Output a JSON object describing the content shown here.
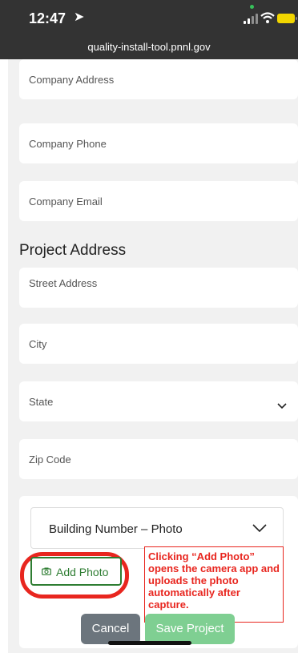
{
  "status": {
    "time": "12:47"
  },
  "browser": {
    "url": "quality-install-tool.pnnl.gov"
  },
  "company_fields": [
    {
      "label": "Company Address"
    },
    {
      "label": "Company Phone"
    },
    {
      "label": "Company Email"
    }
  ],
  "project_address": {
    "title": "Project Address",
    "street": "Street Address",
    "city": "City",
    "state": "State",
    "zip": "Zip Code"
  },
  "photo": {
    "selected": "Building Number – Photo",
    "add_label": "Add Photo"
  },
  "annotation": {
    "text": "Clicking “Add Photo” opens the camera app and uploads the photo automatically after capture."
  },
  "actions": {
    "cancel": "Cancel",
    "save": "Save Project"
  },
  "colors": {
    "accent_green": "#2e7d32",
    "annotation_red": "#e8261f",
    "save_disabled": "#7fcf92"
  },
  "icons": [
    "location-arrow-icon",
    "signal-icon",
    "wifi-icon",
    "battery-icon",
    "chevron-down-icon",
    "camera-add-icon"
  ]
}
